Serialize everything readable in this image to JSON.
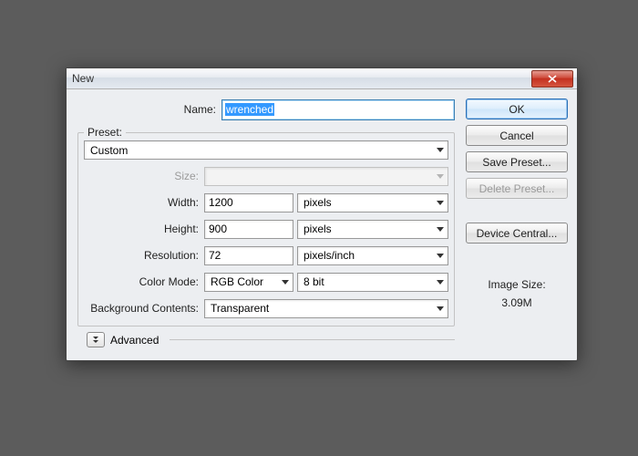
{
  "window": {
    "title": "New"
  },
  "name": {
    "label": "Name:",
    "value": "wrenched"
  },
  "preset": {
    "legend": "Preset:",
    "value": "Custom"
  },
  "size": {
    "label": "Size:",
    "value": ""
  },
  "width": {
    "label": "Width:",
    "value": "1200",
    "unit": "pixels"
  },
  "height": {
    "label": "Height:",
    "value": "900",
    "unit": "pixels"
  },
  "resolution": {
    "label": "Resolution:",
    "value": "72",
    "unit": "pixels/inch"
  },
  "colorMode": {
    "label": "Color Mode:",
    "value": "RGB Color",
    "depth": "8 bit"
  },
  "background": {
    "label": "Background Contents:",
    "value": "Transparent"
  },
  "advanced": {
    "label": "Advanced"
  },
  "buttons": {
    "ok": "OK",
    "cancel": "Cancel",
    "savePreset": "Save Preset...",
    "deletePreset": "Delete Preset...",
    "deviceCentral": "Device Central..."
  },
  "imageSize": {
    "label": "Image Size:",
    "value": "3.09M"
  }
}
